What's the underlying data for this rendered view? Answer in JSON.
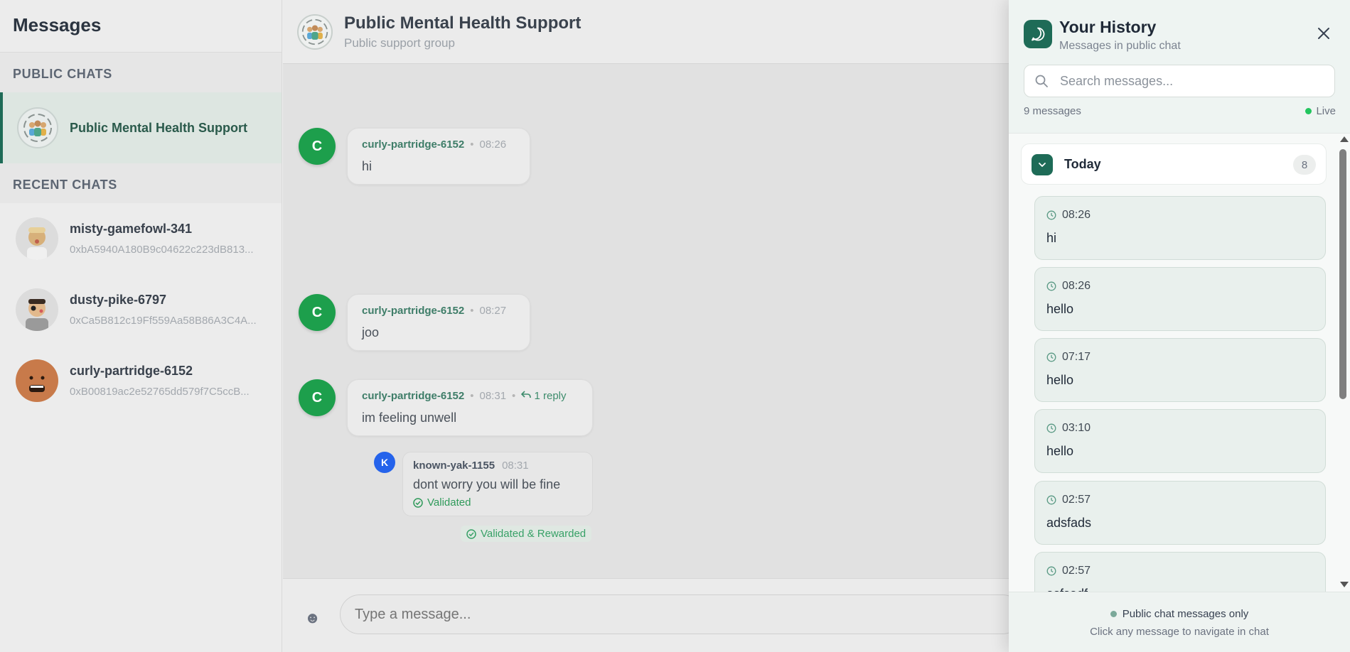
{
  "sidebar": {
    "title": "Messages",
    "public_section": "PUBLIC CHATS",
    "public_chat_name": "Public Mental Health Support",
    "recent_section": "RECENT CHATS",
    "recent": [
      {
        "name": "misty-gamefowl-341",
        "address": "0xbA5940A180B9c04622c223dB813..."
      },
      {
        "name": "dusty-pike-6797",
        "address": "0xCa5B812c19Ff559Aa58B86A3C4A..."
      },
      {
        "name": "curly-partridge-6152",
        "address": "0xB00819ac2e52765dd579f7C5ccB..."
      }
    ]
  },
  "chat": {
    "title": "Public Mental Health Support",
    "subtitle": "Public support group",
    "messages": [
      {
        "avatar": "C",
        "author": "curly-partridge-6152",
        "time": "08:26",
        "text": "hi"
      },
      {
        "avatar": "C",
        "author": "curly-partridge-6152",
        "time": "08:27",
        "text": "joo"
      },
      {
        "avatar": "C",
        "author": "curly-partridge-6152",
        "time": "08:31",
        "replies": "1 reply",
        "text": "im feeling unwell"
      }
    ],
    "reply": {
      "avatar": "K",
      "author": "known-yak-1155",
      "time": "08:31",
      "text": "dont worry you will be fine",
      "status": "Validated"
    },
    "validated_rewarded": "Validated & Rewarded",
    "input_placeholder": "Type a message...",
    "emoji": "☻"
  },
  "history": {
    "title": "Your History",
    "subtitle": "Messages in public chat",
    "search_placeholder": "Search messages...",
    "count": "9 messages",
    "live": "Live",
    "group_label": "Today",
    "group_count": "8",
    "items": [
      {
        "time": "08:26",
        "text": "hi"
      },
      {
        "time": "08:26",
        "text": "hello"
      },
      {
        "time": "07:17",
        "text": "hello"
      },
      {
        "time": "03:10",
        "text": "hello"
      },
      {
        "time": "02:57",
        "text": "adsfads"
      },
      {
        "time": "02:57",
        "text": "asfsadf"
      }
    ],
    "footer_note": "Public chat messages only",
    "footer_hint": "Click any message to navigate in chat"
  },
  "colors": {
    "accent": "#1e6b57",
    "user_avatar": "#1d9f4c",
    "reply_avatar": "#2563eb",
    "live": "#22c55e"
  }
}
